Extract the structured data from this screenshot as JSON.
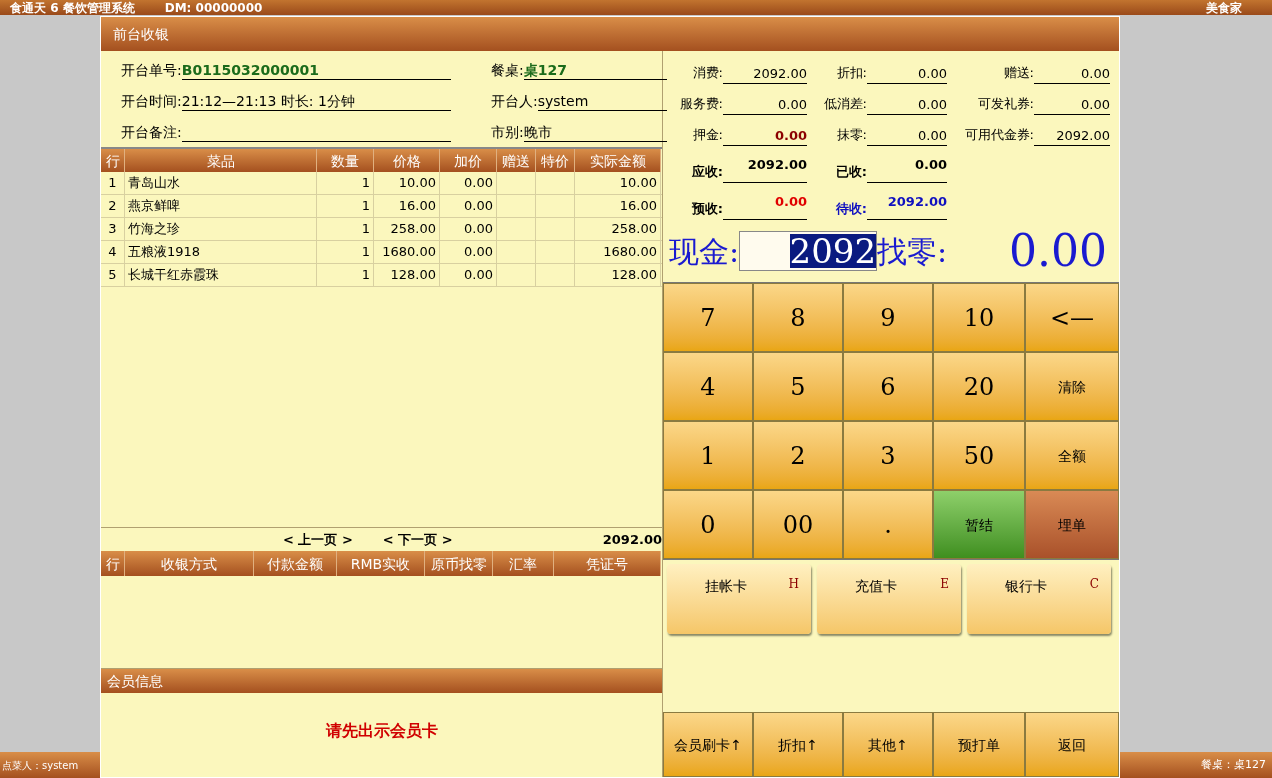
{
  "app_bar": {
    "title": "食通天 6 餐饮管理系统",
    "dm": "DM: 00000000",
    "brand": "美食家"
  },
  "window": {
    "title": "前台收银"
  },
  "order_info": [
    {
      "label": "开台单号:",
      "value": "B0115032000001",
      "kind": "highlight"
    },
    {
      "label": "餐桌:",
      "value": "桌127",
      "kind": "highlight"
    },
    {
      "label": "开台时间:",
      "value": "21:12—21:13  时长: 1分钟",
      "kind": "plain"
    },
    {
      "label": "开台人:",
      "value": "system",
      "kind": "plain"
    },
    {
      "label": "开台备注:",
      "kind": "plain"
    },
    {
      "label": "市别:",
      "value": "晚市",
      "kind": "plain"
    }
  ],
  "items_table": {
    "columns": [
      "行",
      "菜品",
      "数量",
      "价格",
      "加价",
      "赠送",
      "特价",
      "实际金额"
    ],
    "rows": [
      {
        "line": "1",
        "name": "青岛山水",
        "qty": "1",
        "price": "10.00",
        "markup": "0.00",
        "amount": "10.00"
      },
      {
        "line": "2",
        "name": "燕京鲜啤",
        "qty": "1",
        "price": "16.00",
        "markup": "0.00",
        "amount": "16.00"
      },
      {
        "line": "3",
        "name": "竹海之珍",
        "qty": "1",
        "price": "258.00",
        "markup": "0.00",
        "amount": "258.00"
      },
      {
        "line": "4",
        "name": "五粮液1918",
        "qty": "1",
        "price": "1680.00",
        "markup": "0.00",
        "amount": "1680.00"
      },
      {
        "line": "5",
        "name": "长城干红赤霞珠",
        "qty": "1",
        "price": "128.00",
        "markup": "0.00",
        "amount": "128.00"
      }
    ]
  },
  "pagination": {
    "prev": "< 上一页 >",
    "next": "< 下一页 >",
    "total": "2092.00"
  },
  "payments_table": {
    "columns": [
      "行",
      "收银方式",
      "付款金额",
      "RMB实收",
      "原币找零",
      "汇率",
      "凭证号"
    ]
  },
  "member": {
    "title": "会员信息",
    "message": "请先出示会员卡"
  },
  "summary": [
    [
      {
        "label": "消费:",
        "value": "2092.00",
        "kind": "normal"
      },
      {
        "label": "折扣:",
        "value": "0.00",
        "kind": "normal"
      },
      {
        "label": "赠送:",
        "value": "0.00",
        "kind": "normal"
      }
    ],
    [
      {
        "label": "服务费:",
        "value": "0.00",
        "kind": "normal"
      },
      {
        "label": "低消差:",
        "value": "0.00",
        "kind": "normal"
      },
      {
        "label": "可发礼券:",
        "value": "0.00",
        "kind": "normal"
      }
    ],
    [
      {
        "label": "押金:",
        "value": "0.00",
        "kind": "darkred"
      },
      {
        "label": "抹零:",
        "value": "0.00",
        "kind": "normal"
      },
      {
        "label": "可用代金券:",
        "value": "2092.00",
        "kind": "normal"
      }
    ],
    [
      {
        "label": "应收:",
        "value": "2092.00",
        "kind": "bold"
      },
      {
        "label": "已收:",
        "value": "0.00",
        "kind": "bold"
      }
    ],
    [
      {
        "label": "预收:",
        "value": "0.00",
        "kind": "red"
      },
      {
        "label": "待收:",
        "value": "2092.00",
        "kind": "blue"
      }
    ]
  ],
  "cash": {
    "label": "现金:",
    "value": "2092",
    "change_label": "找零:",
    "change": "0.00"
  },
  "keypad": [
    {
      "label": "7",
      "kind": "key"
    },
    {
      "label": "8",
      "kind": "key"
    },
    {
      "label": "9",
      "kind": "key"
    },
    {
      "label": "10",
      "kind": "key"
    },
    {
      "label": "<—",
      "kind": "key"
    },
    {
      "label": "4",
      "kind": "key"
    },
    {
      "label": "5",
      "kind": "key"
    },
    {
      "label": "6",
      "kind": "key"
    },
    {
      "label": "20",
      "kind": "key"
    },
    {
      "label": "清除",
      "kind": "small"
    },
    {
      "label": "1",
      "kind": "key"
    },
    {
      "label": "2",
      "kind": "key"
    },
    {
      "label": "3",
      "kind": "key"
    },
    {
      "label": "50",
      "kind": "key"
    },
    {
      "label": "全额",
      "kind": "small"
    },
    {
      "label": "0",
      "kind": "key"
    },
    {
      "label": "00",
      "kind": "key"
    },
    {
      "label": ".",
      "kind": "key"
    },
    {
      "label": "暂结",
      "kind": "green"
    },
    {
      "label": "埋单",
      "kind": "brown"
    }
  ],
  "payment_cards": [
    {
      "label": "挂帐卡",
      "hotkey": "H"
    },
    {
      "label": "充值卡",
      "hotkey": "E"
    },
    {
      "label": "银行卡",
      "hotkey": "C"
    }
  ],
  "bottom_buttons": [
    "会员刷卡↑",
    "折扣↑",
    "其他↑",
    "预打单",
    "返回"
  ],
  "status": {
    "left": "点菜人：system",
    "right": "餐桌：桌127"
  }
}
